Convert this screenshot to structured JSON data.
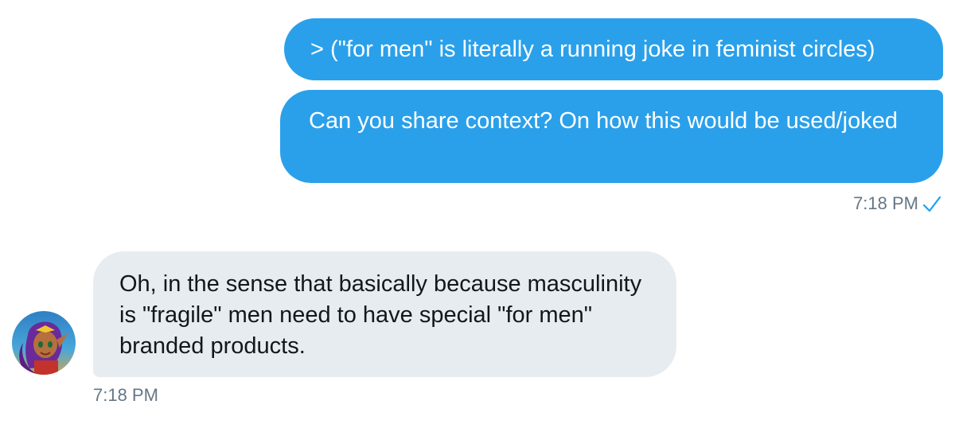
{
  "messages": [
    {
      "direction": "sent",
      "text": "> (\"for men\" is literally a running joke in feminist circles)"
    },
    {
      "direction": "sent",
      "text": "Can you share context? On how this would be used/joked"
    },
    {
      "direction": "received",
      "text": "Oh, in the sense that basically because masculinity is \"fragile\" men need to have special \"for men\" branded products."
    }
  ],
  "sent_timestamp": "7:18 PM",
  "received_timestamp": "7:18 PM",
  "read_status_icon": "checkmark-icon",
  "avatar_icon": "avatar",
  "colors": {
    "sent_bubble": "#2aa0ea",
    "received_bubble": "#e6ecf0",
    "timestamp": "#657786",
    "read_check": "#1da1f2"
  }
}
